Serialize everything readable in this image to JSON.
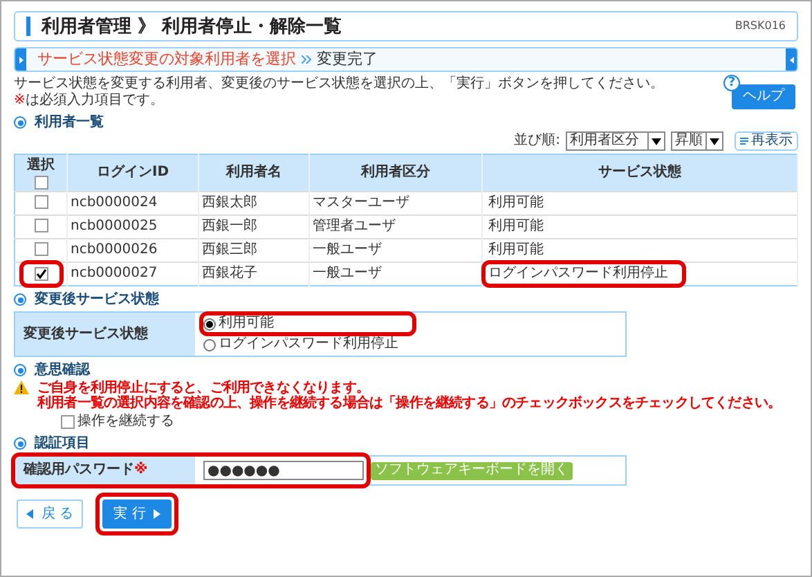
{
  "header": {
    "title": "利用者管理 》 利用者停止・解除一覧",
    "screen_id": "BRSK016"
  },
  "steps": [
    {
      "label": "サービス状態変更の対象利用者を選択",
      "selected": true
    },
    {
      "label": "変更完了",
      "selected": false
    }
  ],
  "intro": {
    "text": "サービス状態を変更する利用者、変更後のサービス状態を選択の上、「実行」ボタンを押してください。",
    "required_mark": "※",
    "required_note": "は必須入力項目です。"
  },
  "help": {
    "icon_text": "?",
    "label": "ヘルプ"
  },
  "user_list": {
    "heading": "利用者一覧",
    "sort_label": "並び順:",
    "sort_key": "利用者区分",
    "sort_order": "昇順",
    "refresh": "再表示",
    "select_all_label": "選択",
    "select_all_checked": false,
    "columns": [
      "ログインID",
      "利用者名",
      "利用者区分",
      "サービス状態"
    ],
    "rows": [
      {
        "checked": false,
        "highlighted": false,
        "cells": [
          "ncb0000024",
          "西銀太郎",
          "マスターユーザ",
          "利用可能"
        ]
      },
      {
        "checked": false,
        "highlighted": false,
        "cells": [
          "ncb0000025",
          "西銀一郎",
          "管理者ユーザ",
          "利用可能"
        ]
      },
      {
        "checked": false,
        "highlighted": false,
        "cells": [
          "ncb0000026",
          "西銀三郎",
          "一般ユーザ",
          "利用可能"
        ]
      },
      {
        "checked": true,
        "highlighted": true,
        "cells": [
          "ncb0000027",
          "西銀花子",
          "一般ユーザ",
          "ログインパスワード利用停止"
        ]
      }
    ]
  },
  "new_status": {
    "heading": "変更後サービス状態",
    "label": "変更後サービス状態",
    "options": [
      {
        "label": "利用可能",
        "selected": true,
        "highlighted": true
      },
      {
        "label": "ログインパスワード利用停止",
        "selected": false,
        "highlighted": false
      }
    ]
  },
  "confirm": {
    "heading": "意思確認",
    "warning": [
      "ご自身を利用停止にすると、ご利用できなくなります。",
      "利用者一覧の選択内容を確認の上、操作を継続する場合は「操作を継続する」のチェックボックスをチェックしてください。"
    ],
    "checkbox_label": "操作を継続する",
    "checked": false
  },
  "auth": {
    "heading": "認証項目",
    "label": "確認用パスワード",
    "required_mark": "※",
    "value": "●●●●●●",
    "keyboard_button": "ソフトウェアキーボードを開く",
    "highlighted": true
  },
  "buttons": [
    {
      "kind": "back",
      "label": "戻 る",
      "highlighted": false
    },
    {
      "kind": "execute",
      "label": "実 行",
      "highlighted": true
    }
  ]
}
